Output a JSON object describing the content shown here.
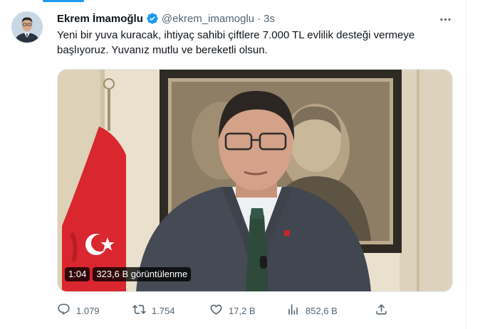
{
  "author": {
    "display_name": "Ekrem İmamoğlu",
    "handle": "@ekrem_imamoglu",
    "separator": "·",
    "time": "3s"
  },
  "tweet": {
    "text": "Yeni bir yuva kuracak, ihtiyaç sahibi çiftlere 7.000 TL evlilik desteği vermeye başlıyoruz. Yuvanız mutlu ve bereketli olsun."
  },
  "video": {
    "duration": "1:04",
    "views": "323,6 B görüntülenme"
  },
  "actions": {
    "replies": "1.079",
    "reposts": "1.754",
    "likes": "17,2 B",
    "views": "852,6 B"
  },
  "icons": {
    "verified": "verified-badge-icon",
    "more": "more-dots-icon",
    "reply": "reply-icon",
    "repost": "repost-icon",
    "like": "heart-icon",
    "views": "views-chart-icon",
    "share": "share-icon"
  },
  "colors": {
    "accent": "#1d9bf0",
    "muted": "#536471",
    "text": "#0f1419"
  }
}
